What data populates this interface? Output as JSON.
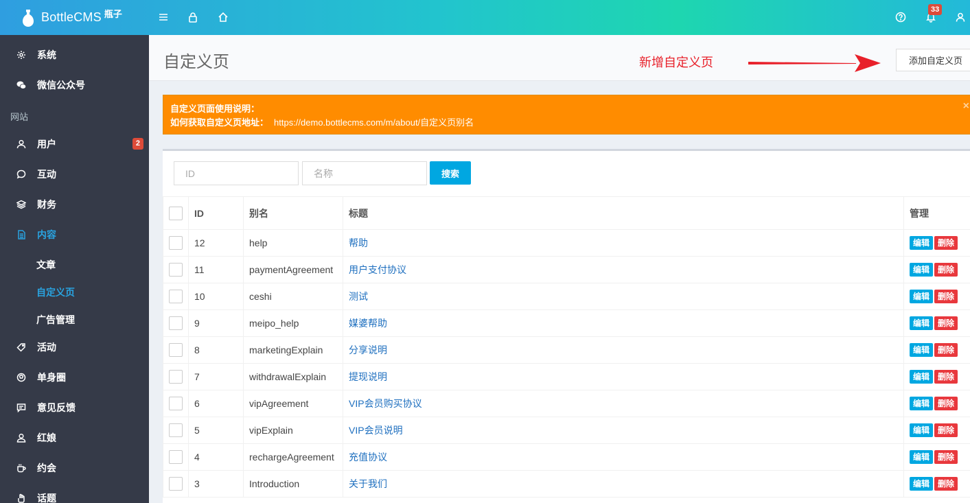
{
  "brand": {
    "name": "BottleCMS",
    "sup": "瓶子"
  },
  "topbar": {
    "notifications_count": "33"
  },
  "sidebar": {
    "items": [
      {
        "label": "系统",
        "icon": "gear-icon"
      },
      {
        "label": "微信公众号",
        "icon": "wechat-icon"
      },
      {
        "label": "用户",
        "icon": "user-icon",
        "badge": "2"
      },
      {
        "label": "互动",
        "icon": "chat-icon"
      },
      {
        "label": "财务",
        "icon": "layers-icon"
      },
      {
        "label": "内容",
        "icon": "document-icon"
      },
      {
        "label": "活动",
        "icon": "tag-icon"
      },
      {
        "label": "单身圈",
        "icon": "ball-icon"
      },
      {
        "label": "意见反馈",
        "icon": "message-icon"
      },
      {
        "label": "红娘",
        "icon": "person-icon"
      },
      {
        "label": "约会",
        "icon": "cup-icon"
      },
      {
        "label": "话题",
        "icon": "hand-icon"
      }
    ],
    "header": "网站",
    "sub_items": [
      "文章",
      "自定义页",
      "广告管理"
    ]
  },
  "page": {
    "title": "自定义页",
    "annotation": "新增自定义页",
    "add_button": "添加自定义页"
  },
  "alert": {
    "line1": "自定义页面使用说明：",
    "line2_label": "如何获取自定义页地址：",
    "line2_url": "https://demo.bottlecms.com/m/about/自定义页别名",
    "close": "×"
  },
  "search": {
    "id_placeholder": "ID",
    "name_placeholder": "名称",
    "button": "搜索"
  },
  "table": {
    "headers": {
      "id": "ID",
      "alias": "别名",
      "title": "标题",
      "manage": "管理"
    },
    "edit_label": "编辑",
    "delete_label": "删除",
    "rows": [
      {
        "id": "12",
        "alias": "help",
        "title": "帮助"
      },
      {
        "id": "11",
        "alias": "paymentAgreement",
        "title": "用户支付协议"
      },
      {
        "id": "10",
        "alias": "ceshi",
        "title": "测试"
      },
      {
        "id": "9",
        "alias": "meipo_help",
        "title": "媒婆帮助"
      },
      {
        "id": "8",
        "alias": "marketingExplain",
        "title": "分享说明"
      },
      {
        "id": "7",
        "alias": "withdrawalExplain",
        "title": "提现说明"
      },
      {
        "id": "6",
        "alias": "vipAgreement",
        "title": "VIP会员购买协议"
      },
      {
        "id": "5",
        "alias": "vipExplain",
        "title": "VIP会员说明"
      },
      {
        "id": "4",
        "alias": "rechargeAgreement",
        "title": "充值协议"
      },
      {
        "id": "3",
        "alias": "Introduction",
        "title": "关于我们"
      }
    ]
  },
  "colors": {
    "accent": "#29a3e0",
    "sidebar": "#353a48",
    "danger": "#e8383d",
    "warning": "#ff8c00"
  }
}
